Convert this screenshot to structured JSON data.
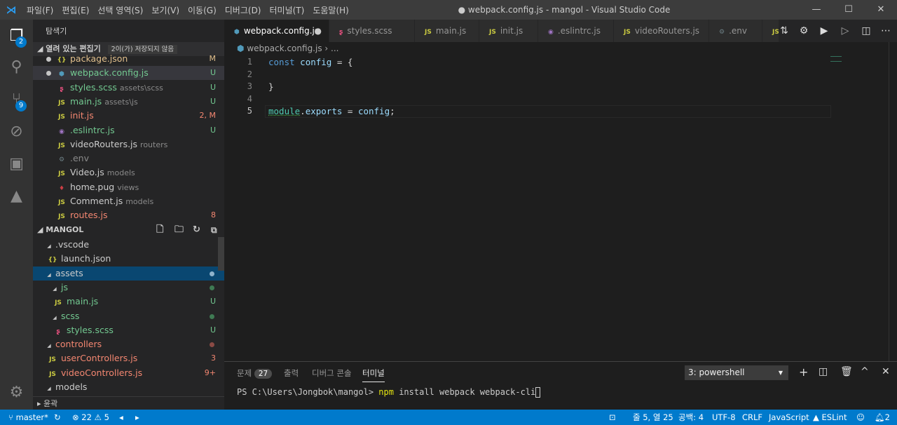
{
  "titlebar": {
    "title": "● webpack.config.js - mangol - Visual Studio Code",
    "menu": [
      "파일(F)",
      "편집(E)",
      "선택 영역(S)",
      "보기(V)",
      "이동(G)",
      "디버그(D)",
      "터미널(T)",
      "도움말(H)"
    ]
  },
  "activity": {
    "explorer_badge": "2",
    "scm_badge": "9"
  },
  "sidebar": {
    "title": "탐색기",
    "open_editors": {
      "label": "열려 있는 편집기",
      "unsaved": "2이(가) 저장되지 않음",
      "items": [
        {
          "icon": "{}",
          "name": "package.json",
          "desc": "",
          "status": "M",
          "color": "y",
          "dirty": true
        },
        {
          "icon": "⬢",
          "name": "webpack.config.js",
          "desc": "",
          "status": "U",
          "color": "g",
          "dirty": true
        },
        {
          "icon": "ʂ",
          "name": "styles.scss",
          "desc": "assets\\scss",
          "status": "U",
          "color": "g"
        },
        {
          "icon": "JS",
          "name": "main.js",
          "desc": "assets\\js",
          "status": "U",
          "color": "g"
        },
        {
          "icon": "JS",
          "name": "init.js",
          "desc": "",
          "status": "2, M",
          "color": "r"
        },
        {
          "icon": "◉",
          "name": ".eslintrc.js",
          "desc": "",
          "status": "U",
          "color": "g"
        },
        {
          "icon": "JS",
          "name": "videoRouters.js",
          "desc": "routers",
          "status": "",
          "color": "w"
        },
        {
          "icon": "⚙",
          "name": ".env",
          "desc": "",
          "status": "",
          "color": "gray"
        },
        {
          "icon": "JS",
          "name": "Video.js",
          "desc": "models",
          "status": "",
          "color": "w"
        },
        {
          "icon": "♦",
          "name": "home.pug",
          "desc": "views",
          "status": "",
          "color": "w"
        },
        {
          "icon": "JS",
          "name": "Comment.js",
          "desc": "models",
          "status": "",
          "color": "w"
        },
        {
          "icon": "JS",
          "name": "routes.js",
          "desc": "",
          "status": "8",
          "color": "r"
        }
      ]
    },
    "project": {
      "label": "MANGOL",
      "items": [
        {
          "indent": 1,
          "icon": "◢",
          "name": ".vscode",
          "status": "",
          "color": "w"
        },
        {
          "indent": 2,
          "icon": "{}",
          "name": "launch.json",
          "status": "",
          "color": "w"
        },
        {
          "indent": 1,
          "icon": "◢",
          "name": "assets",
          "status": "dot",
          "color": "w",
          "selected": true
        },
        {
          "indent": 2,
          "icon": "◢",
          "name": "js",
          "status": "dot",
          "color": "g"
        },
        {
          "indent": 3,
          "icon": "JS",
          "name": "main.js",
          "status": "U",
          "color": "g"
        },
        {
          "indent": 2,
          "icon": "◢",
          "name": "scss",
          "status": "dot",
          "color": "g"
        },
        {
          "indent": 3,
          "icon": "ʂ",
          "name": "styles.scss",
          "status": "U",
          "color": "g"
        },
        {
          "indent": 1,
          "icon": "◢",
          "name": "controllers",
          "status": "dot",
          "color": "r"
        },
        {
          "indent": 2,
          "icon": "JS",
          "name": "userControllers.js",
          "status": "3",
          "color": "r"
        },
        {
          "indent": 2,
          "icon": "JS",
          "name": "videoControllers.js",
          "status": "9+",
          "color": "r"
        },
        {
          "indent": 1,
          "icon": "◢",
          "name": "models",
          "status": "",
          "color": "w"
        }
      ]
    },
    "outline": "윤곽"
  },
  "tabs": [
    {
      "name": "webpack.config.js",
      "icon": "⬢",
      "active": true,
      "dirty": true
    },
    {
      "name": "styles.scss",
      "icon": "ʂ"
    },
    {
      "name": "main.js",
      "icon": "JS"
    },
    {
      "name": "init.js",
      "icon": "JS"
    },
    {
      "name": ".eslintrc.js",
      "icon": "◉"
    },
    {
      "name": "videoRouters.js",
      "icon": "JS"
    },
    {
      "name": ".env",
      "icon": "⚙"
    },
    {
      "name": "",
      "icon": "JS"
    }
  ],
  "breadcrumb": {
    "file": "webpack.config.js",
    "rest": "› ..."
  },
  "editor": {
    "lines": [
      "1",
      "2",
      "3",
      "4",
      "5"
    ]
  },
  "panel": {
    "tabs": [
      "문제",
      "출력",
      "디버그 콘솔",
      "터미널"
    ],
    "problems_count": "27",
    "terminal_select": "3: powershell",
    "prompt": "PS C:\\Users\\Jongbok\\mangol> ",
    "cmd": "npm",
    "args": " install webpack webpack-cli"
  },
  "statusbar": {
    "branch": "master*",
    "errors": "22",
    "warnings": "5",
    "position": "줄 5, 열 25",
    "spaces": "공백: 4",
    "encoding": "UTF-8",
    "eol": "CRLF",
    "language": "JavaScript",
    "eslint": "ESLint",
    "notifications": "2"
  }
}
